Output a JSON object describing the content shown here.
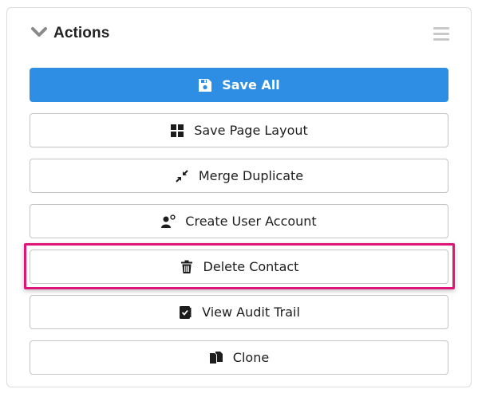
{
  "panel": {
    "title": "Actions",
    "collapse_icon": "chevron-down-icon",
    "menu_icon": "hamburger-menu-icon"
  },
  "buttons": [
    {
      "label": "Save All",
      "icon": "save-icon",
      "style": "primary"
    },
    {
      "label": "Save Page Layout",
      "icon": "layout-grid-icon",
      "style": "default"
    },
    {
      "label": "Merge Duplicate",
      "icon": "compress-arrows-icon",
      "style": "default"
    },
    {
      "label": "Create User Account",
      "icon": "user-gear-icon",
      "style": "default"
    },
    {
      "label": "Delete Contact",
      "icon": "trash-icon",
      "style": "default",
      "highlighted": true
    },
    {
      "label": "View Audit Trail",
      "icon": "audit-book-icon",
      "style": "default"
    },
    {
      "label": "Clone",
      "icon": "copy-icon",
      "style": "default"
    }
  ],
  "colors": {
    "primary": "#2e8ee4",
    "highlight_border": "#e0157a"
  }
}
